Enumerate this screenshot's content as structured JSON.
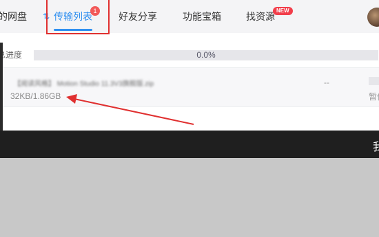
{
  "nav": {
    "items": [
      {
        "label": "的网盘"
      },
      {
        "label": "传输列表"
      },
      {
        "label": "好友分享"
      },
      {
        "label": "功能宝箱"
      },
      {
        "label": "找资源"
      }
    ],
    "transfer_badge": "1",
    "new_badge": "NEW"
  },
  "progress": {
    "label": "总进度",
    "value_text": "0.0%",
    "fraction": 0.0
  },
  "file": {
    "name": "【阅读风格】 Motion Studio 11.3V3旗舰版.zip",
    "size": "32KB/1.86GB",
    "speed": "--",
    "status": "暂停"
  },
  "bottom_bar": {
    "text": "我"
  },
  "colors": {
    "accent": "#2f8ff0",
    "annotation_red": "#e03030"
  }
}
